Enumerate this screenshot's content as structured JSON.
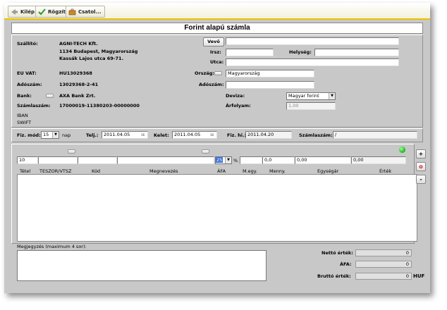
{
  "toolbar": {
    "exit_label": "Kilép",
    "save_label": "Rögzít",
    "attach_label": "Csatol..."
  },
  "title": "Forint alapú számla",
  "supplier": {
    "label": "Szállító:",
    "name": "AGNI-TECH Kft.",
    "address1": "1134 Budapest, Magyarország",
    "address2": "Kassák Lajos utca 69-71.",
    "eu_vat_label": "EU VAT:",
    "eu_vat": "HU13029368",
    "tax_label": "Adószám:",
    "tax": "13029368-2-41",
    "bank_label": "Bank:",
    "bank": "AXA Bank Zrt.",
    "account_label": "Számlaszám:",
    "account": "17000019-11380203-00000000",
    "iban_label": "IBAN",
    "swift_label": "SWIFT"
  },
  "buyer": {
    "button_label": "Vevő",
    "name_value": "",
    "zip_label": "Irsz:",
    "zip_value": "",
    "city_label": "Helység:",
    "city_value": "",
    "street_label": "Utca:",
    "street_value": "",
    "country_label": "Ország:",
    "country_value": "Magyarország",
    "tax_label": "Adószám:",
    "tax_value": "",
    "currency_label": "Deviza:",
    "currency_value": "Magyar forint",
    "rate_label": "Árfolyam:",
    "rate_value": "1,00"
  },
  "payment": {
    "method_label": "Fiz. mód:",
    "days_value": "15",
    "days_unit": "nap",
    "perf_label": "Telj.:",
    "perf_value": "2011.04.05",
    "issue_label": "Kelet:",
    "issue_value": "2011.04.05",
    "due_label": "Fiz. hi.:",
    "due_value": "2011.04.20",
    "invoice_no_label": "Számlaszám:",
    "invoice_no_value": "/"
  },
  "entry_row": {
    "item_no": "10",
    "vat_value": "25",
    "percent": "%",
    "qty": "0,0",
    "unit_price": "0,00",
    "value": "0,00"
  },
  "columns": [
    "Tétel",
    "TESZOR/VTSZ",
    "Kód",
    "Megnevezés",
    "ÁFA",
    "M.egy.",
    "Menny.",
    "Egységár",
    "Érték"
  ],
  "side_buttons": {
    "add": "+",
    "remove": "o",
    "minus": "-"
  },
  "notes": {
    "label": "Megjegyzés (maximum 4 sor):",
    "value": ""
  },
  "totals": {
    "net_label": "Nettó érték:",
    "net_value": "0",
    "vat_label": "ÁFA:",
    "vat_value": "0",
    "gross_label": "Bruttó érték:",
    "gross_value": "0",
    "currency": "HUF"
  },
  "colors": {
    "accent": "#e9c400",
    "status": "#22cc22"
  }
}
